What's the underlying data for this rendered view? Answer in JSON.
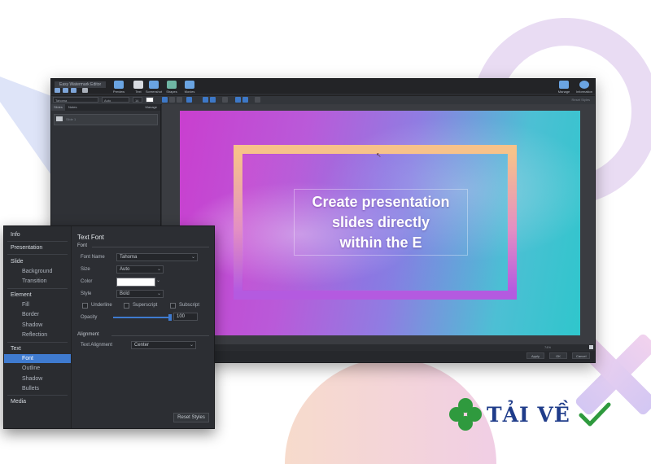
{
  "window": {
    "title": "Easy Watermark Editor",
    "toolbar": [
      {
        "label": "Preview",
        "icon": "preview-icon"
      },
      {
        "label": "Text",
        "icon": "text-icon"
      },
      {
        "label": "Screenshot",
        "icon": "screenshot-icon"
      },
      {
        "label": "Shapes",
        "icon": "shapes-icon"
      },
      {
        "label": "Movies",
        "icon": "movies-icon"
      }
    ],
    "toolbar_right": [
      {
        "label": "Manage",
        "icon": "manage-icon"
      },
      {
        "label": "Information",
        "icon": "info-icon"
      }
    ],
    "format": {
      "font": "Tahoma",
      "size": "Auto",
      "size_value": "14"
    },
    "format_right": "Reset Styles",
    "left_tabs": [
      "Slides",
      "Notes"
    ],
    "left_manage": "Manage",
    "slide_item": "Slide 1",
    "zoom": "74%",
    "buttons": {
      "apply": "Apply",
      "ok": "OK",
      "cancel": "Cancel"
    }
  },
  "slide": {
    "text_line1": "Create presentation",
    "text_line2": "slides directly",
    "text_line3": "within the E"
  },
  "panel": {
    "nav": [
      {
        "label": "Info",
        "type": "cat"
      },
      {
        "label": "Presentation",
        "type": "cat"
      },
      {
        "label": "Slide",
        "type": "cat"
      },
      {
        "label": "Background",
        "type": "sub"
      },
      {
        "label": "Transition",
        "type": "sub"
      },
      {
        "label": "Element",
        "type": "cat"
      },
      {
        "label": "Fill",
        "type": "sub"
      },
      {
        "label": "Border",
        "type": "sub"
      },
      {
        "label": "Shadow",
        "type": "sub"
      },
      {
        "label": "Reflection",
        "type": "sub"
      },
      {
        "label": "Text",
        "type": "cat"
      },
      {
        "label": "Font",
        "type": "sub",
        "selected": true
      },
      {
        "label": "Outline",
        "type": "sub"
      },
      {
        "label": "Shadow",
        "type": "sub"
      },
      {
        "label": "Bullets",
        "type": "sub"
      },
      {
        "label": "Media",
        "type": "cat"
      }
    ],
    "heading": "Text Font",
    "font_section": "Font",
    "font_name_label": "Font Name",
    "font_name_value": "Tahoma",
    "size_label": "Size",
    "size_value": "Auto",
    "color_label": "Color",
    "color_value": "#ffffff",
    "style_label": "Style",
    "style_value": "Bold",
    "underline": "Underline",
    "superscript": "Superscript",
    "subscript": "Subscript",
    "opacity_label": "Opacity",
    "opacity_value": "100",
    "opacity_fraction": 1.0,
    "alignment_section": "Alignment",
    "text_alignment_label": "Text Alignment",
    "text_alignment_value": "Center",
    "reset_button": "Reset Styles"
  },
  "watermark": {
    "text": "TẢI VỀ"
  },
  "colors": {
    "accent": "#3f7bd0",
    "logo_text": "#1f3c8a",
    "clover": "#2f9a3e"
  }
}
